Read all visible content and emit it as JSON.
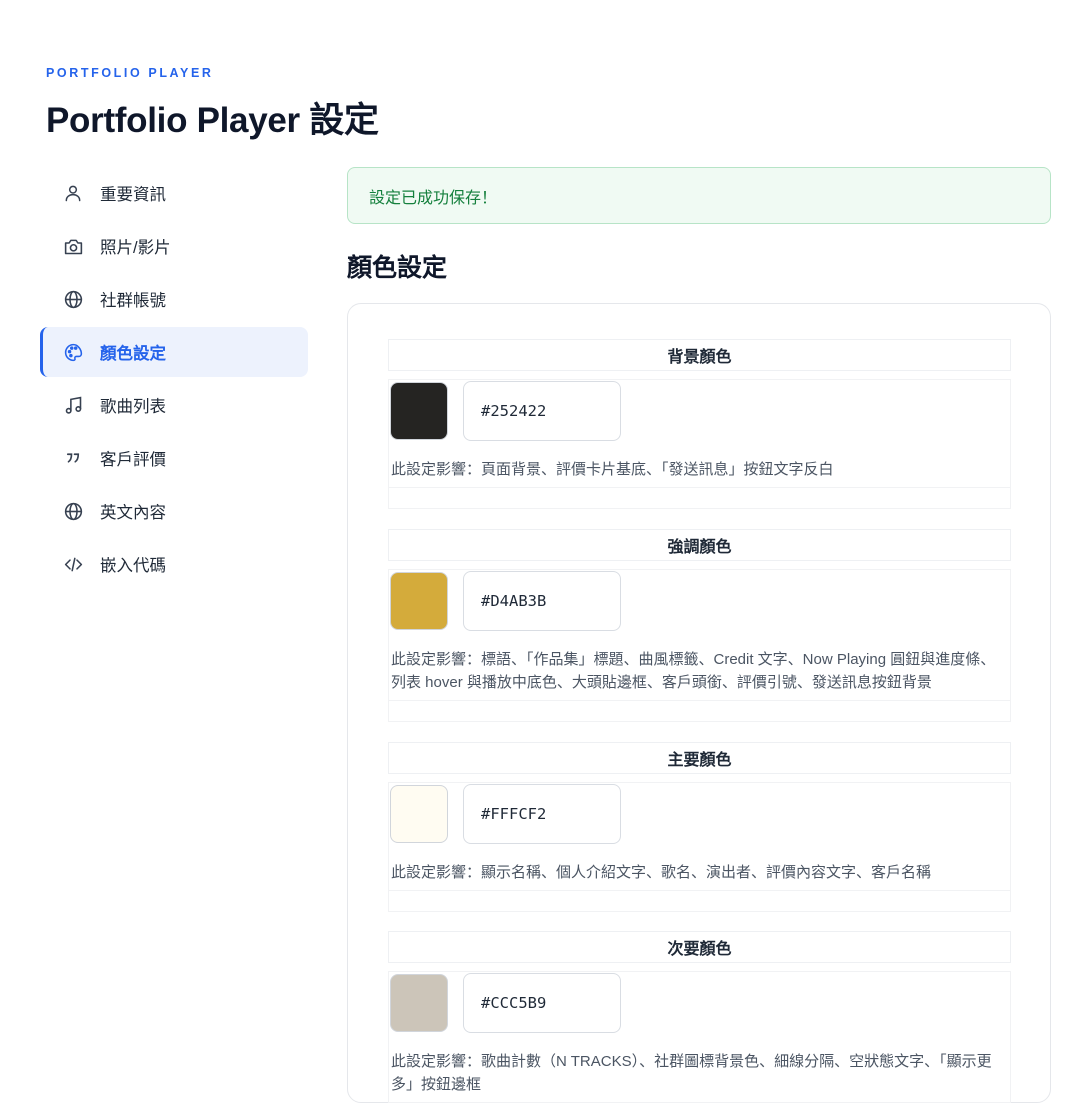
{
  "header": {
    "eyebrow": "PORTFOLIO PLAYER",
    "title": "Portfolio Player 設定"
  },
  "sidebar": {
    "items": [
      {
        "label": "重要資訊",
        "icon": "user-icon",
        "active": false
      },
      {
        "label": "照片/影片",
        "icon": "camera-icon",
        "active": false
      },
      {
        "label": "社群帳號",
        "icon": "globe-icon",
        "active": false
      },
      {
        "label": "顏色設定",
        "icon": "palette-icon",
        "active": true
      },
      {
        "label": "歌曲列表",
        "icon": "music-note-icon",
        "active": false
      },
      {
        "label": "客戶評價",
        "icon": "quote-icon",
        "active": false
      },
      {
        "label": "英文內容",
        "icon": "globe-icon",
        "active": false
      },
      {
        "label": "嵌入代碼",
        "icon": "code-icon",
        "active": false
      }
    ],
    "active_color": "#2563eb"
  },
  "alert": {
    "message": "設定已成功保存！",
    "color": "#15803d"
  },
  "section": {
    "title": "顏色設定"
  },
  "colors": [
    {
      "title": "背景顏色",
      "value": "#252422",
      "swatch": "#252422",
      "description": "此設定影響：頁面背景、評價卡片基底、「發送訊息」按鈕文字反白"
    },
    {
      "title": "強調顏色",
      "value": "#D4AB3B",
      "swatch": "#D4AB3B",
      "description": "此設定影響：標語、「作品集」標題、曲風標籤、Credit 文字、Now Playing 圓鈕與進度條、列表 hover 與播放中底色、大頭貼邊框、客戶頭銜、評價引號、發送訊息按鈕背景"
    },
    {
      "title": "主要顏色",
      "value": "#FFFCF2",
      "swatch": "#FFFCF2",
      "description": "此設定影響：顯示名稱、個人介紹文字、歌名、演出者、評價內容文字、客戶名稱"
    },
    {
      "title": "次要顏色",
      "value": "#CCC5B9",
      "swatch": "#CCC5B9",
      "description": "此設定影響：歌曲計數（N TRACKS）、社群圖標背景色、細線分隔、空狀態文字、「顯示更多」按鈕邊框"
    }
  ]
}
